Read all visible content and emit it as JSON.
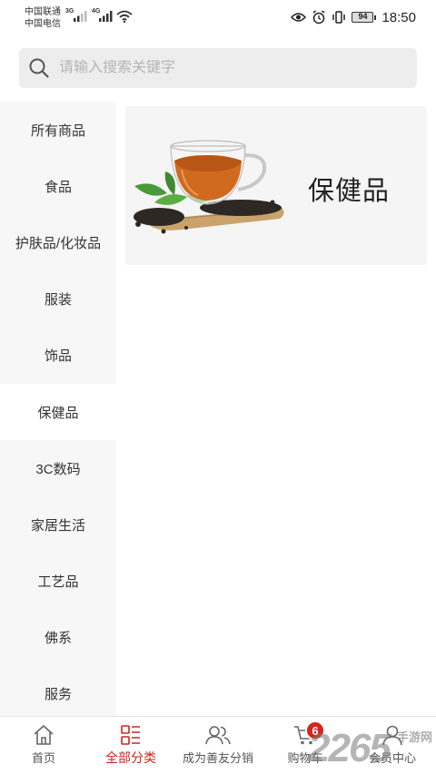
{
  "status_bar": {
    "carrier_1": "中国联通",
    "carrier_2": "中国电信",
    "net_1": "3G",
    "net_2": "4G",
    "battery": "94",
    "time": "18:50"
  },
  "search": {
    "placeholder": "请输入搜索关键字"
  },
  "sidebar": {
    "items": [
      {
        "label": "所有商品"
      },
      {
        "label": "食品"
      },
      {
        "label": "护肤品/化妆品"
      },
      {
        "label": "服装"
      },
      {
        "label": "饰品"
      },
      {
        "label": "保健品"
      },
      {
        "label": "3C数码"
      },
      {
        "label": "家居生活"
      },
      {
        "label": "工艺品"
      },
      {
        "label": "佛系"
      },
      {
        "label": "服务"
      }
    ],
    "active_index": 5
  },
  "content": {
    "category_title": "保健品"
  },
  "tabbar": {
    "items": [
      {
        "label": "首页",
        "icon": "home-icon"
      },
      {
        "label": "全部分类",
        "icon": "category-icon",
        "active": true
      },
      {
        "label": "成为善友分销",
        "icon": "users-icon"
      },
      {
        "label": "购物车",
        "icon": "cart-icon",
        "badge": "6"
      },
      {
        "label": "会员中心",
        "icon": "user-icon"
      }
    ]
  },
  "watermark": {
    "big": "2265",
    "small": "手游网",
    "domain": ".com"
  },
  "colors": {
    "accent": "#c9251d",
    "badge": "#d8241e",
    "sidebar_bg": "#f7f7f7",
    "search_bg": "#ededed"
  }
}
